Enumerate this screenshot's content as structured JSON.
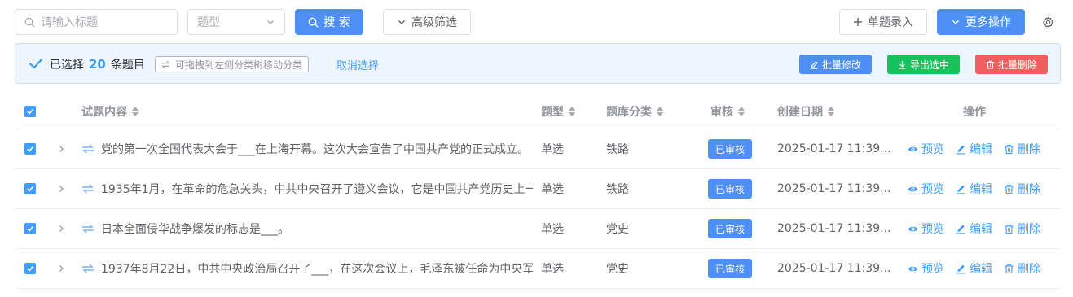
{
  "toolbar": {
    "search_placeholder": "请输入标题",
    "type_select_placeholder": "题型",
    "search_button": "搜 索",
    "advanced_filter_button": "高级筛选",
    "single_entry_button": "单题录入",
    "more_actions_button": "更多操作",
    "settings_icon": "gear-icon"
  },
  "selection_bar": {
    "prefix": "已选择",
    "count": "20",
    "suffix": "条题目",
    "drag_hint": "可拖拽到左侧分类树移动分类",
    "cancel_link": "取消选择",
    "batch_edit": "批量修改",
    "export_selected": "导出选中",
    "batch_delete": "批量删除"
  },
  "colors": {
    "primary": "#4e8ff6",
    "link": "#409eff",
    "success": "#19c15d",
    "danger": "#f25d5d"
  },
  "table": {
    "headers": {
      "content": "试题内容",
      "type": "题型",
      "category": "题库分类",
      "review": "审核",
      "created": "创建日期",
      "actions": "操作"
    },
    "rows": [
      {
        "content": "党的第一次全国代表大会于___在上海开幕。这次大会宣告了中国共产党的正式成立。",
        "type": "单选",
        "category": "铁路",
        "status": "已审核",
        "created": "2025-01-17 11:39...",
        "preview": "预览",
        "edit": "编辑",
        "delete": "删除"
      },
      {
        "content": "1935年1月，在革命的危急关头，中共中央召开了遵义会议，它是中国共产党历史上一",
        "type": "单选",
        "category": "铁路",
        "status": "已审核",
        "created": "2025-01-17 11:39...",
        "preview": "预览",
        "edit": "编辑",
        "delete": "删除"
      },
      {
        "content": "日本全面侵华战争爆发的标志是___。",
        "type": "单选",
        "category": "党史",
        "status": "已审核",
        "created": "2025-01-17 11:39...",
        "preview": "预览",
        "edit": "编辑",
        "delete": "删除"
      },
      {
        "content": "1937年8月22日，中共中央政治局召开了___，在这次会议上，毛泽东被任命为中央军",
        "type": "单选",
        "category": "党史",
        "status": "已审核",
        "created": "2025-01-17 11:39...",
        "preview": "预览",
        "edit": "编辑",
        "delete": "删除"
      }
    ]
  }
}
